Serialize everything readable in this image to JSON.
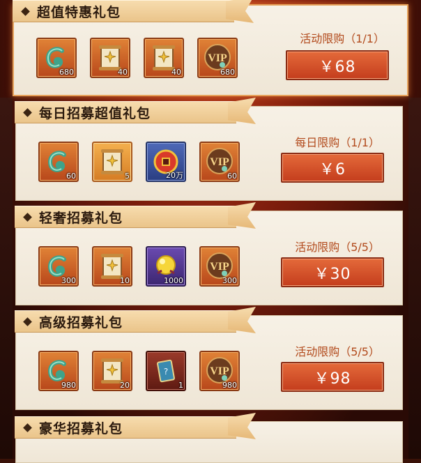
{
  "packs": [
    {
      "title": "超值特惠礼包",
      "limit": "活动限购（1/1）",
      "price": "￥68",
      "items": [
        {
          "icon": "jade-dragon-icon",
          "qty": "680"
        },
        {
          "icon": "recruit-scroll-icon",
          "qty": "40"
        },
        {
          "icon": "recruit-scroll-icon",
          "qty": "40"
        },
        {
          "icon": "vip-badge-icon",
          "qty": "680"
        }
      ]
    },
    {
      "title": "每日招募超值礼包",
      "limit": "每日限购（1/1）",
      "price": "￥6",
      "items": [
        {
          "icon": "jade-dragon-icon",
          "qty": "60"
        },
        {
          "icon": "recruit-scroll-icon",
          "qty": "5"
        },
        {
          "icon": "copper-coin-icon",
          "qty": "20万"
        },
        {
          "icon": "vip-badge-icon",
          "qty": "60"
        }
      ]
    },
    {
      "title": "轻奢招募礼包",
      "limit": "活动限购（5/5）",
      "price": "￥30",
      "items": [
        {
          "icon": "jade-dragon-icon",
          "qty": "300"
        },
        {
          "icon": "recruit-scroll-icon",
          "qty": "10"
        },
        {
          "icon": "golden-orb-icon",
          "qty": "1000"
        },
        {
          "icon": "vip-badge-icon",
          "qty": "300"
        }
      ]
    },
    {
      "title": "高级招募礼包",
      "limit": "活动限购（5/5）",
      "price": "￥98",
      "items": [
        {
          "icon": "jade-dragon-icon",
          "qty": "980"
        },
        {
          "icon": "recruit-scroll-icon",
          "qty": "20"
        },
        {
          "icon": "card-frame-icon",
          "qty": "1"
        },
        {
          "icon": "vip-badge-icon",
          "qty": "980"
        }
      ]
    },
    {
      "title": "豪华招募礼包"
    }
  ],
  "colors": {
    "accent": "#c43d1d",
    "limit_text": "#b24a1c",
    "header": "#eac48a"
  }
}
